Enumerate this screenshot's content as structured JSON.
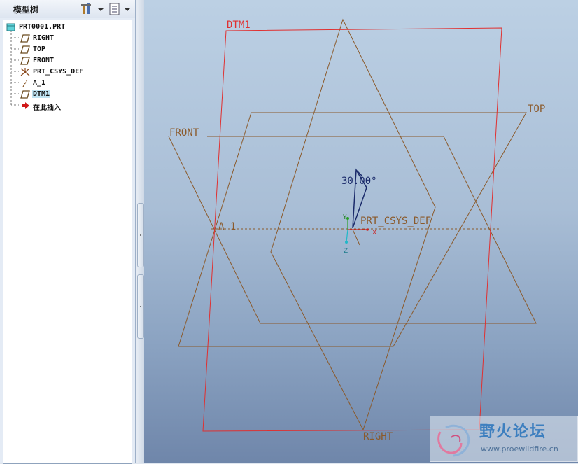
{
  "model_tree": {
    "title": "模型树",
    "root": "PRT0001.PRT",
    "items": [
      {
        "label": "RIGHT",
        "icon": "datum-plane-icon"
      },
      {
        "label": "TOP",
        "icon": "datum-plane-icon"
      },
      {
        "label": "FRONT",
        "icon": "datum-plane-icon"
      },
      {
        "label": "PRT_CSYS_DEF",
        "icon": "coordinate-system-icon"
      },
      {
        "label": "A_1",
        "icon": "datum-axis-icon"
      },
      {
        "label": "DTM1",
        "icon": "datum-plane-icon",
        "selected": true
      },
      {
        "label": "在此插入",
        "icon": "insert-here-arrow-icon"
      }
    ]
  },
  "viewport": {
    "labels": {
      "dtm1": "DTM1",
      "top": "TOP",
      "front": "FRONT",
      "right": "RIGHT",
      "axis": "A_1",
      "csys": "PRT_CSYS_DEF",
      "angle": "30.00°",
      "x_axis": "X",
      "y_axis": "Y",
      "z_axis": "Z"
    },
    "colors": {
      "datum_plane": "#8b5a2b",
      "selected_plane": "#e03030",
      "dimension": "#1a2a6a"
    }
  },
  "watermark": {
    "title": "野火论坛",
    "url": "www.proewildfire.cn"
  }
}
